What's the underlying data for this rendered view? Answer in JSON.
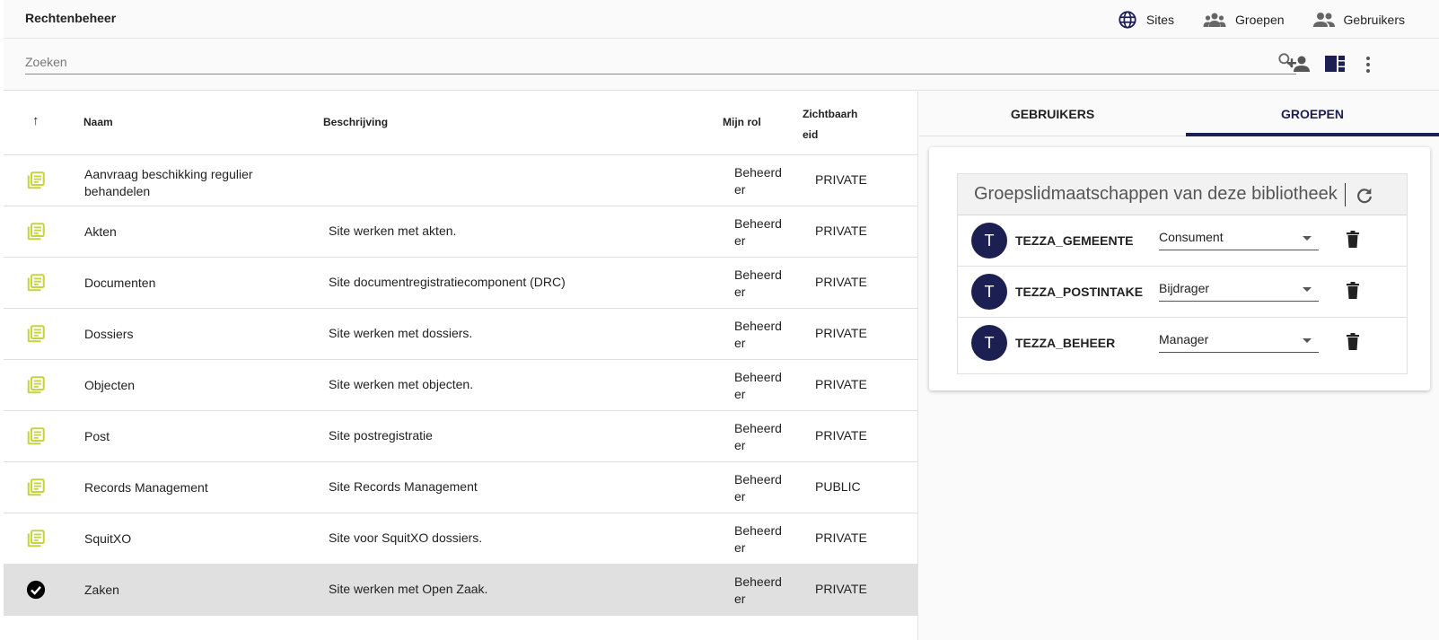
{
  "app": {
    "title": "Rechtenbeheer"
  },
  "nav": [
    {
      "label": "Sites",
      "icon": "globe-icon"
    },
    {
      "label": "Groepen",
      "icon": "groups-icon"
    },
    {
      "label": "Gebruikers",
      "icon": "users-icon"
    }
  ],
  "search": {
    "placeholder": "Zoeken",
    "value": ""
  },
  "toolbar": {
    "icons": [
      "add-user-icon",
      "layout-icon",
      "more-vert-icon"
    ]
  },
  "table": {
    "headers": {
      "sort": "↑",
      "name": "Naam",
      "description": "Beschrijving",
      "role": "Mijn rol",
      "visibility": "Zichtbaarh eid"
    },
    "rows": [
      {
        "name": "Aanvraag beschikking regulier behandelen",
        "description": "",
        "role": "Beheerd er",
        "visibility": "PRIVATE",
        "selected": false
      },
      {
        "name": "Akten",
        "description": "Site werken met akten.",
        "role": "Beheerd er",
        "visibility": "PRIVATE",
        "selected": false
      },
      {
        "name": "Documenten",
        "description": "Site documentregistratiecomponent (DRC)",
        "role": "Beheerd er",
        "visibility": "PRIVATE",
        "selected": false
      },
      {
        "name": "Dossiers",
        "description": "Site werken met dossiers.",
        "role": "Beheerd er",
        "visibility": "PRIVATE",
        "selected": false
      },
      {
        "name": "Objecten",
        "description": "Site werken met objecten.",
        "role": "Beheerd er",
        "visibility": "PRIVATE",
        "selected": false
      },
      {
        "name": "Post",
        "description": "Site postregistratie",
        "role": "Beheerd er",
        "visibility": "PRIVATE",
        "selected": false
      },
      {
        "name": "Records Management",
        "description": "Site Records Management",
        "role": "Beheerd er",
        "visibility": "PUBLIC",
        "selected": false
      },
      {
        "name": "SquitXO",
        "description": "Site voor SquitXO dossiers.",
        "role": "Beheerd er",
        "visibility": "PRIVATE",
        "selected": false
      },
      {
        "name": "Zaken",
        "description": "Site werken met Open Zaak.",
        "role": "Beheerd er",
        "visibility": "PRIVATE",
        "selected": true
      }
    ]
  },
  "panel": {
    "tabs": [
      {
        "label": "GEBRUIKERS",
        "active": false
      },
      {
        "label": "GROEPEN",
        "active": true
      }
    ],
    "group_header": "Groepslidmaatschappen van deze bibliotheek",
    "groups": [
      {
        "initial": "T",
        "name": "TEZZA_GEMEENTE",
        "role": "Consument"
      },
      {
        "initial": "T",
        "name": "TEZZA_POSTINTAKE",
        "role": "Bijdrager"
      },
      {
        "initial": "T",
        "name": "TEZZA_BEHEER",
        "role": "Manager"
      }
    ]
  },
  "colors": {
    "accent": "#1b1f52",
    "site_icon": "#c5d440",
    "selected_row": "#e0e0e0"
  }
}
